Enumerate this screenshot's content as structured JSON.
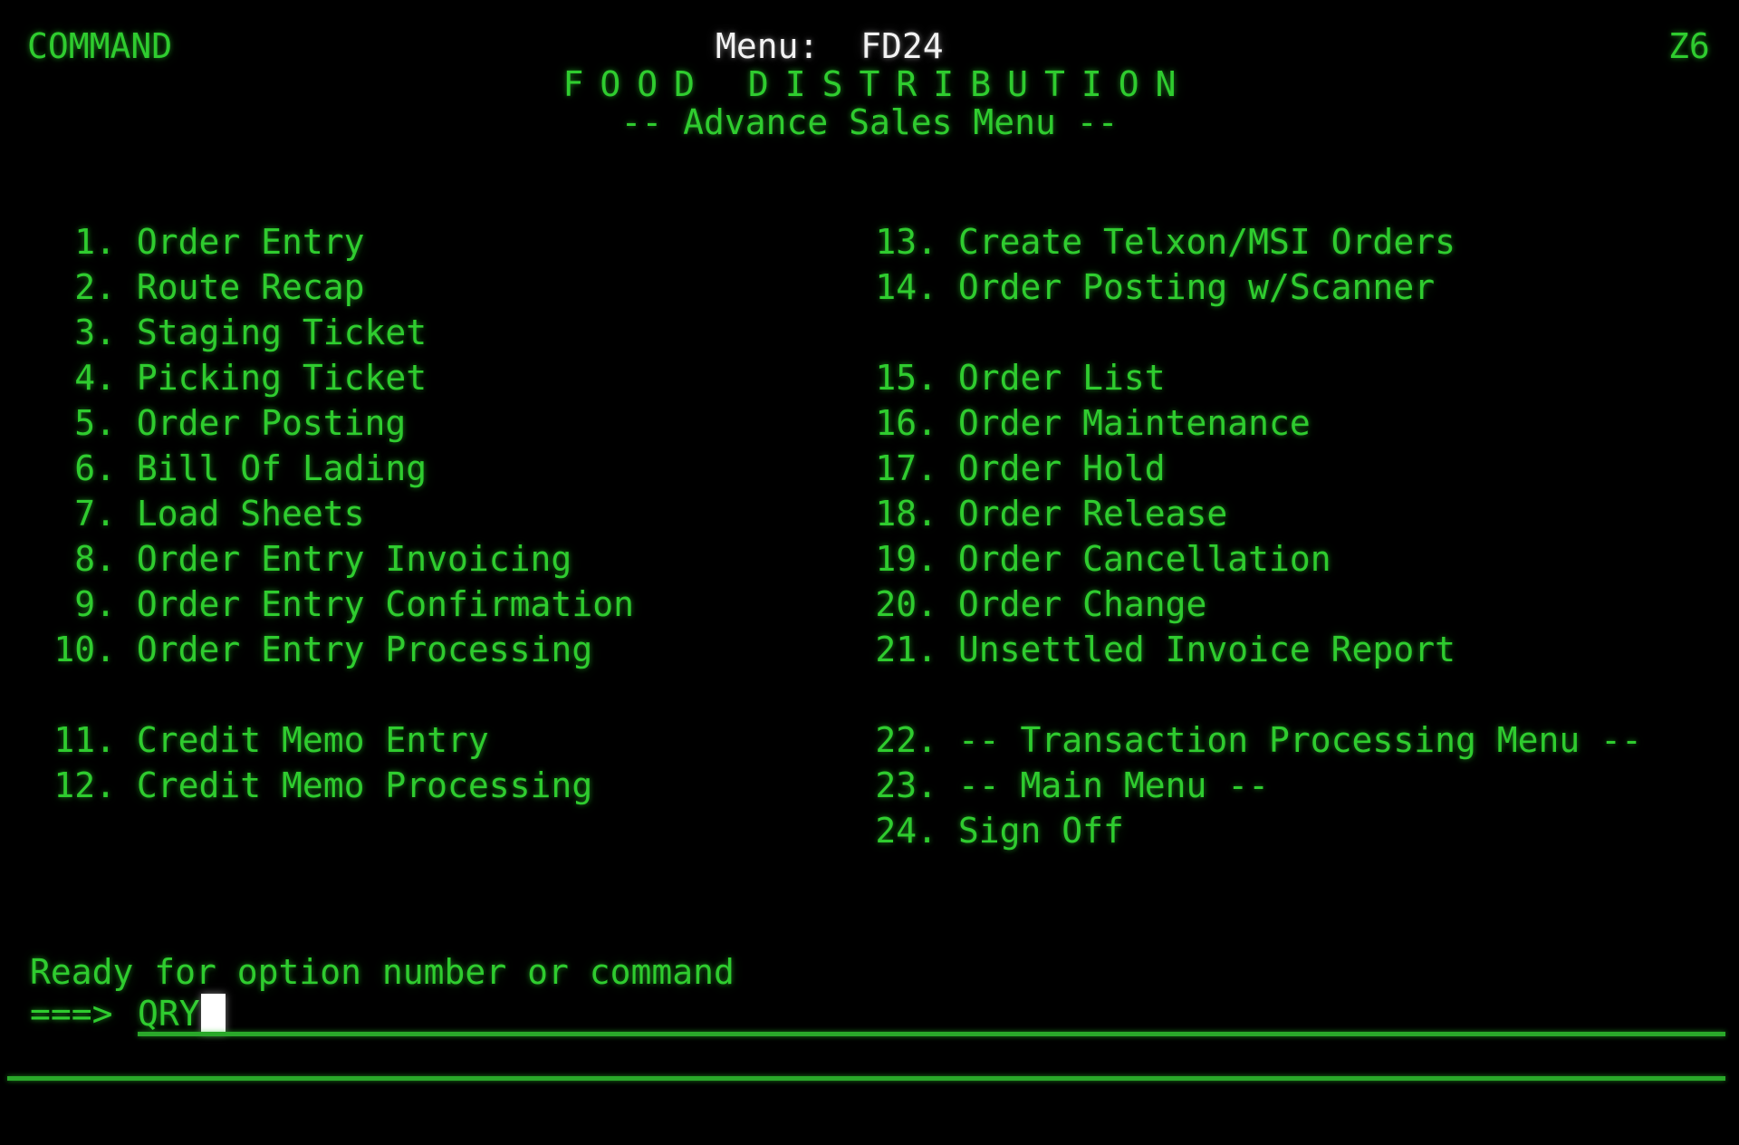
{
  "screen": {
    "background_color": "#000000",
    "text_color": "#2fcc2f",
    "highlight_color": "#f2f2f2",
    "rule_color": "#2aa82a"
  },
  "header": {
    "command_label": "COMMAND",
    "menu_id": "Menu:  FD24",
    "session_id": "Z6"
  },
  "titles": {
    "application": "FOOD DISTRIBUTION",
    "subtitle": "-- Advance Sales Menu --"
  },
  "menu": {
    "left_column": [
      {
        "number": "1.",
        "label": "Order Entry"
      },
      {
        "number": "2.",
        "label": "Route Recap"
      },
      {
        "number": "3.",
        "label": "Staging Ticket"
      },
      {
        "number": "4.",
        "label": "Picking Ticket"
      },
      {
        "number": "5.",
        "label": "Order Posting"
      },
      {
        "number": "6.",
        "label": "Bill Of Lading"
      },
      {
        "number": "7.",
        "label": "Load Sheets"
      },
      {
        "number": "8.",
        "label": "Order Entry Invoicing"
      },
      {
        "number": "9.",
        "label": "Order Entry Confirmation"
      },
      {
        "number": "10.",
        "label": "Order Entry Processing"
      },
      {
        "number": "",
        "label": ""
      },
      {
        "number": "11.",
        "label": "Credit Memo Entry"
      },
      {
        "number": "12.",
        "label": "Credit Memo Processing"
      }
    ],
    "right_column": [
      {
        "number": "13.",
        "label": "Create Telxon/MSI Orders"
      },
      {
        "number": "14.",
        "label": "Order Posting w/Scanner"
      },
      {
        "number": "",
        "label": ""
      },
      {
        "number": "15.",
        "label": "Order List"
      },
      {
        "number": "16.",
        "label": "Order Maintenance"
      },
      {
        "number": "17.",
        "label": "Order Hold"
      },
      {
        "number": "18.",
        "label": "Order Release"
      },
      {
        "number": "19.",
        "label": "Order Cancellation"
      },
      {
        "number": "20.",
        "label": "Order Change"
      },
      {
        "number": "21.",
        "label": "Unsettled Invoice Report"
      },
      {
        "number": "",
        "label": ""
      },
      {
        "number": "22.",
        "label": "-- Transaction Processing Menu --"
      },
      {
        "number": "23.",
        "label": "-- Main Menu --"
      },
      {
        "number": "24.",
        "label": "Sign Off"
      }
    ]
  },
  "prompt": {
    "status_text": "Ready for option number or command",
    "arrow": "===>",
    "command_value": "QRY",
    "command_placeholder": ""
  }
}
